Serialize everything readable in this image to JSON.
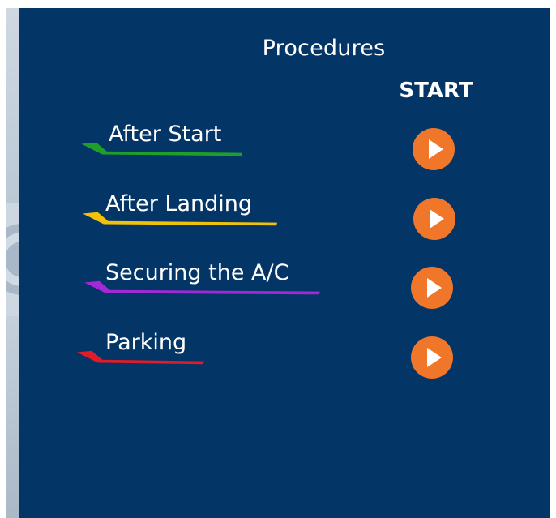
{
  "panel": {
    "title": "Procedures",
    "start_header": "START"
  },
  "procedures": [
    {
      "label": "After Start",
      "color": "#1f9e2a"
    },
    {
      "label": "After Landing",
      "color": "#f2c10a"
    },
    {
      "label": "Securing the A/C",
      "color": "#a329d8"
    },
    {
      "label": "Parking",
      "color": "#e01b2a"
    }
  ],
  "colors": {
    "panel_background": "#033567",
    "play_button": "#f0762a",
    "text": "#ffffff"
  },
  "icons": {
    "play": "play-icon"
  }
}
